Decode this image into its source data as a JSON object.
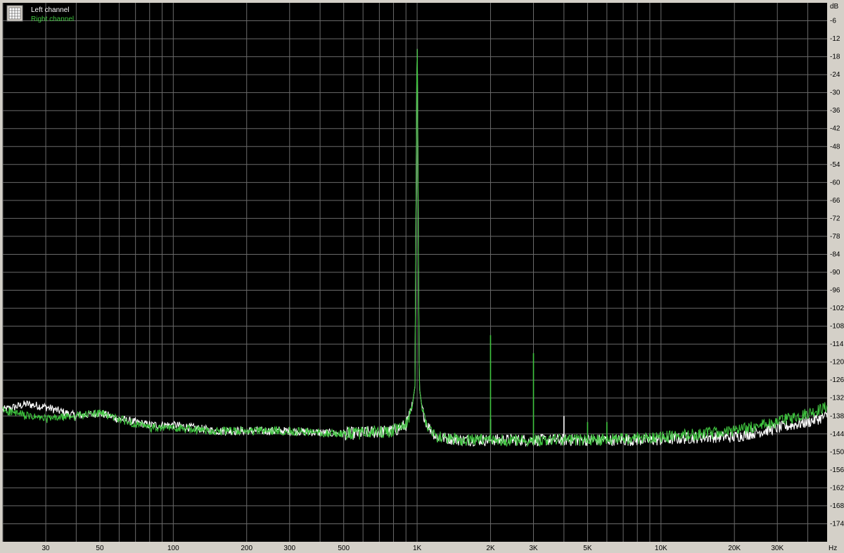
{
  "chart_data": {
    "type": "line",
    "xscale": "log",
    "xlim": [
      20,
      48000
    ],
    "ylim": [
      -180,
      0
    ],
    "grid": true,
    "legend_position": "top-left",
    "x_unit": "Hz",
    "y_unit": "dB",
    "yticks": [
      -6,
      -12,
      -18,
      -24,
      -30,
      -36,
      -42,
      -48,
      -54,
      -60,
      -66,
      -72,
      -78,
      -84,
      -90,
      -96,
      -102,
      -108,
      -114,
      -120,
      -126,
      -132,
      -138,
      -144,
      -150,
      -156,
      -162,
      -168,
      -174
    ],
    "xticks": [
      {
        "value": 30,
        "label": "30"
      },
      {
        "value": 50,
        "label": "50"
      },
      {
        "value": 100,
        "label": "100"
      },
      {
        "value": 200,
        "label": "200"
      },
      {
        "value": 300,
        "label": "300"
      },
      {
        "value": 500,
        "label": "500"
      },
      {
        "value": 1000,
        "label": "1K"
      },
      {
        "value": 2000,
        "label": "2K"
      },
      {
        "value": 3000,
        "label": "3K"
      },
      {
        "value": 5000,
        "label": "5K"
      },
      {
        "value": 10000,
        "label": "10K"
      },
      {
        "value": 20000,
        "label": "20K"
      },
      {
        "value": 30000,
        "label": "30K"
      }
    ],
    "series": [
      {
        "name": "Left channel",
        "color": "#ffffff",
        "points": [
          [
            20,
            -136
          ],
          [
            25,
            -134
          ],
          [
            30,
            -135
          ],
          [
            40,
            -138
          ],
          [
            50,
            -137
          ],
          [
            60,
            -139
          ],
          [
            80,
            -141
          ],
          [
            100,
            -141
          ],
          [
            150,
            -143
          ],
          [
            200,
            -143
          ],
          [
            300,
            -143
          ],
          [
            500,
            -144
          ],
          [
            800,
            -143
          ],
          [
            900,
            -141
          ],
          [
            950,
            -136
          ],
          [
            980,
            -128
          ],
          [
            1000,
            -4
          ],
          [
            1020,
            -128
          ],
          [
            1050,
            -136
          ],
          [
            1100,
            -141
          ],
          [
            1200,
            -145
          ],
          [
            1500,
            -146
          ],
          [
            2000,
            -146
          ],
          [
            3000,
            -146
          ],
          [
            5000,
            -146
          ],
          [
            10000,
            -146
          ],
          [
            15000,
            -145
          ],
          [
            20000,
            -145
          ],
          [
            30000,
            -142
          ],
          [
            40000,
            -140
          ],
          [
            48000,
            -138
          ]
        ],
        "spikes": [
          [
            2000,
            -139
          ],
          [
            3000,
            -144
          ],
          [
            4000,
            -138
          ],
          [
            5000,
            -144
          ],
          [
            6000,
            -145
          ]
        ]
      },
      {
        "name": "Right channel",
        "color": "#3fc43f",
        "points": [
          [
            20,
            -136
          ],
          [
            25,
            -138
          ],
          [
            30,
            -139
          ],
          [
            40,
            -138
          ],
          [
            50,
            -137
          ],
          [
            60,
            -139
          ],
          [
            80,
            -142
          ],
          [
            100,
            -142
          ],
          [
            150,
            -143
          ],
          [
            200,
            -143
          ],
          [
            300,
            -143
          ],
          [
            500,
            -144
          ],
          [
            800,
            -143
          ],
          [
            900,
            -141
          ],
          [
            950,
            -136
          ],
          [
            980,
            -128
          ],
          [
            1000,
            -4
          ],
          [
            1020,
            -128
          ],
          [
            1050,
            -136
          ],
          [
            1100,
            -141
          ],
          [
            1200,
            -145
          ],
          [
            1500,
            -146
          ],
          [
            2000,
            -146
          ],
          [
            3000,
            -146
          ],
          [
            5000,
            -146
          ],
          [
            10000,
            -145
          ],
          [
            15000,
            -144
          ],
          [
            20000,
            -143
          ],
          [
            30000,
            -140
          ],
          [
            40000,
            -137
          ],
          [
            48000,
            -135
          ]
        ],
        "spikes": [
          [
            2000,
            -111
          ],
          [
            3000,
            -117
          ],
          [
            4000,
            -146
          ],
          [
            5000,
            -140
          ],
          [
            6000,
            -140
          ]
        ]
      }
    ]
  }
}
